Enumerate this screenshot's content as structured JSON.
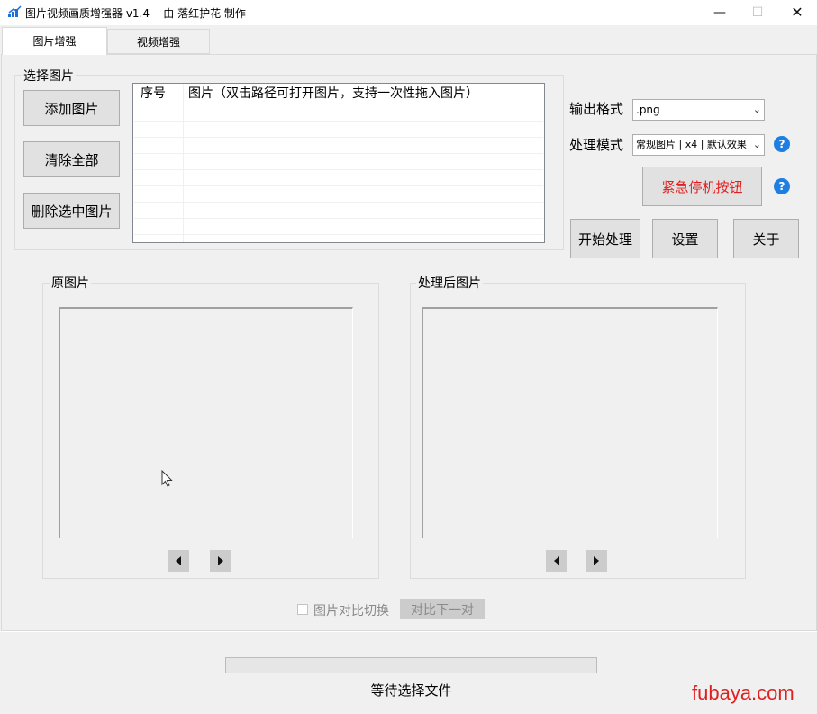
{
  "window": {
    "title": "图片视频画质增强器 v1.4    由 落红护花 制作",
    "min_label": "—",
    "max_label": "☐",
    "close_label": "✕"
  },
  "tabs": [
    {
      "label": "图片增强",
      "active": true
    },
    {
      "label": "视频增强",
      "active": false
    }
  ],
  "select_group": {
    "legend": "选择图片",
    "add_button": "添加图片",
    "clear_button": "清除全部",
    "delete_button": "删除选中图片"
  },
  "list": {
    "columns": [
      "序号",
      "图片（双击路径可打开图片，支持一次性拖入图片）"
    ],
    "rows": []
  },
  "settings": {
    "format_label": "输出格式",
    "format_value": ".png",
    "mode_label": "处理模式",
    "mode_value": "常规图片 | x4 | 默认效果",
    "help_glyph": "?",
    "stop_button": "紧急停机按钮",
    "start_button": "开始处理",
    "settings_button": "设置",
    "about_button": "关于"
  },
  "original": {
    "legend": "原图片"
  },
  "processed": {
    "legend": "处理后图片"
  },
  "compare": {
    "checkbox_label": "图片对比切换",
    "checked": false,
    "next_pair_button": "对比下一对"
  },
  "status": {
    "text": "等待选择文件",
    "progress": 0
  },
  "watermark": "fubaya.com",
  "colors": {
    "accent_blue": "#1e7fe0",
    "stop_red": "#e02020",
    "watermark_red": "#e01f1f"
  }
}
